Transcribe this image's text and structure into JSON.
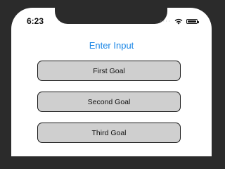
{
  "status_bar": {
    "time": "6:23",
    "signal_glyph": "····",
    "icons": [
      "signal-dots-icon",
      "wifi-icon",
      "battery-icon"
    ]
  },
  "header": {
    "title": "Enter Input",
    "title_color": "#1a86e6"
  },
  "goals": [
    {
      "label": "First Goal"
    },
    {
      "label": "Second Goal"
    },
    {
      "label": "Third Goal"
    }
  ],
  "colors": {
    "button_fill": "#cfcfcf",
    "button_border": "#1b1b1b",
    "bezel": "#2b2b2b"
  }
}
